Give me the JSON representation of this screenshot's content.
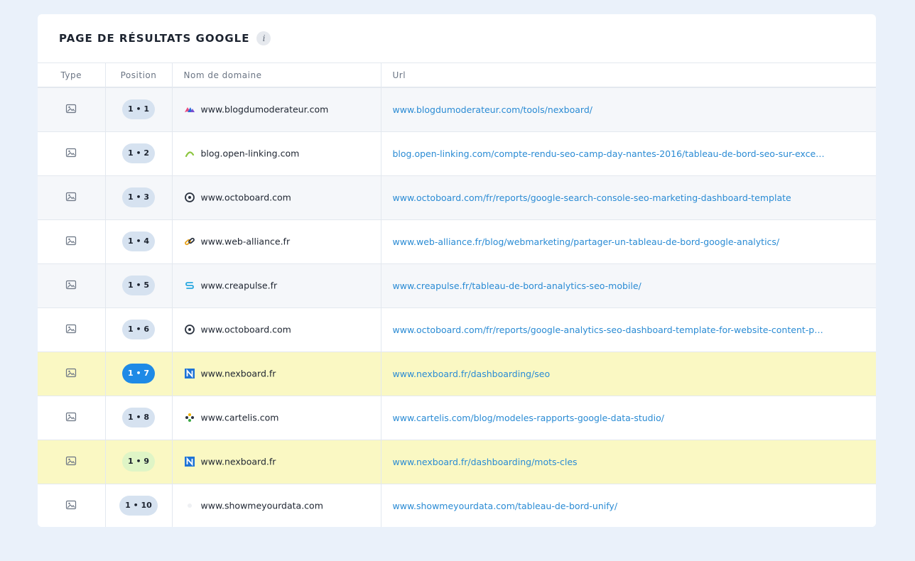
{
  "panel": {
    "title": "PAGE DE RÉSULTATS GOOGLE",
    "info": "i"
  },
  "columns": {
    "type": "Type",
    "position": "Position",
    "domain": "Nom de domaine",
    "url": "Url"
  },
  "rows": [
    {
      "position": "1 • 1",
      "favicon": "blogdumoderateur-favicon",
      "domain": "www.blogdumoderateur.com",
      "url": "www.blogdumoderateur.com/tools/nexboard/",
      "highlight": false,
      "badge": "default"
    },
    {
      "position": "1 • 2",
      "favicon": "open-linking-favicon",
      "domain": "blog.open-linking.com",
      "url": "blog.open-linking.com/compte-rendu-seo-camp-day-nantes-2016/tableau-de-bord-seo-sur-exce…",
      "highlight": false,
      "badge": "default"
    },
    {
      "position": "1 • 3",
      "favicon": "octoboard-favicon",
      "domain": "www.octoboard.com",
      "url": "www.octoboard.com/fr/reports/google-search-console-seo-marketing-dashboard-template",
      "highlight": false,
      "badge": "default"
    },
    {
      "position": "1 • 4",
      "favicon": "web-alliance-favicon",
      "domain": "www.web-alliance.fr",
      "url": "www.web-alliance.fr/blog/webmarketing/partager-un-tableau-de-bord-google-analytics/",
      "highlight": false,
      "badge": "default"
    },
    {
      "position": "1 • 5",
      "favicon": "creapulse-favicon",
      "domain": "www.creapulse.fr",
      "url": "www.creapulse.fr/tableau-de-bord-analytics-seo-mobile/",
      "highlight": false,
      "badge": "default"
    },
    {
      "position": "1 • 6",
      "favicon": "octoboard-favicon",
      "domain": "www.octoboard.com",
      "url": "www.octoboard.com/fr/reports/google-analytics-seo-dashboard-template-for-website-content-p…",
      "highlight": false,
      "badge": "default"
    },
    {
      "position": "1 • 7",
      "favicon": "nexboard-favicon",
      "domain": "www.nexboard.fr",
      "url": "www.nexboard.fr/dashboarding/seo",
      "highlight": true,
      "badge": "blue"
    },
    {
      "position": "1 • 8",
      "favicon": "cartelis-favicon",
      "domain": "www.cartelis.com",
      "url": "www.cartelis.com/blog/modeles-rapports-google-data-studio/",
      "highlight": false,
      "badge": "default"
    },
    {
      "position": "1 • 9",
      "favicon": "nexboard-favicon",
      "domain": "www.nexboard.fr",
      "url": "www.nexboard.fr/dashboarding/mots-cles",
      "highlight": true,
      "badge": "green"
    },
    {
      "position": "1 • 10",
      "favicon": "showmeyourdata-favicon",
      "domain": "www.showmeyourdata.com",
      "url": "www.showmeyourdata.com/tableau-de-bord-unify/",
      "highlight": false,
      "badge": "default"
    }
  ],
  "colors": {
    "background": "#eaf1fa",
    "highlight": "#faf8c3",
    "badge_blue": "#1e8ae6",
    "badge_green": "#dff5c6",
    "link": "#2a8bd4"
  }
}
